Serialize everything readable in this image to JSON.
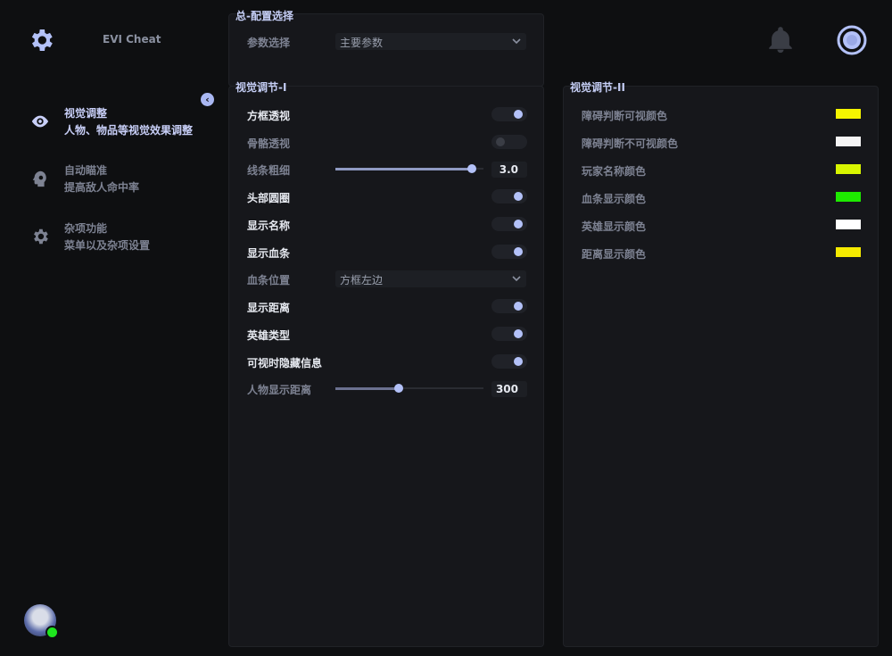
{
  "app": {
    "title": "EVI Cheat"
  },
  "sidebar": {
    "collapse_glyph": "‹",
    "items": [
      {
        "title": "视觉调整",
        "subtitle": "人物、物品等视觉效果调整",
        "icon": "eye-icon",
        "active": true
      },
      {
        "title": "自动瞄准",
        "subtitle": "提高敌人命中率",
        "icon": "head-gear-icon",
        "active": false
      },
      {
        "title": "杂项功能",
        "subtitle": "菜单以及杂项设置",
        "icon": "gear-icon",
        "active": false
      }
    ],
    "user": {
      "status": "online",
      "status_color": "#1ee61e"
    }
  },
  "header": {
    "icons": [
      "bell-icon",
      "ring-icon"
    ]
  },
  "config_panel": {
    "title": "总-配置选择",
    "param_label": "参数选择",
    "param_value": "主要参数"
  },
  "visual_panel_1": {
    "title": "视觉调节-I",
    "rows": {
      "box_esp": {
        "label": "方框透视",
        "on": true
      },
      "skeleton_esp": {
        "label": "骨骼透视",
        "on": false
      },
      "line_width": {
        "label": "线条粗细",
        "value": "3.0",
        "fraction": 0.92
      },
      "head_circle": {
        "label": "头部圆圈",
        "on": true
      },
      "show_name": {
        "label": "显示名称",
        "on": true
      },
      "show_health": {
        "label": "显示血条",
        "on": true
      },
      "health_position": {
        "label": "血条位置",
        "value": "方框左边"
      },
      "show_distance": {
        "label": "显示距离",
        "on": true
      },
      "hero_type": {
        "label": "英雄类型",
        "on": true
      },
      "hide_info_visible": {
        "label": "可视时隐藏信息",
        "on": true
      },
      "player_distance": {
        "label": "人物显示距离",
        "value": "300",
        "fraction": 0.43
      }
    }
  },
  "visual_panel_2": {
    "title": "视觉调节-II",
    "colors": [
      {
        "label": "障碍判断可视颜色",
        "color": "#f5f500"
      },
      {
        "label": "障碍判断不可视颜色",
        "color": "#f5f5f5"
      },
      {
        "label": "玩家名称颜色",
        "color": "#d8f500"
      },
      {
        "label": "血条显示颜色",
        "color": "#1eea00"
      },
      {
        "label": "英雄显示颜色",
        "color": "#ffffff"
      },
      {
        "label": "距离显示颜色",
        "color": "#f5ea00"
      }
    ]
  },
  "theme": {
    "accent": "#b3c1f8",
    "background": "#0e0f11",
    "panel": "#16171b"
  }
}
